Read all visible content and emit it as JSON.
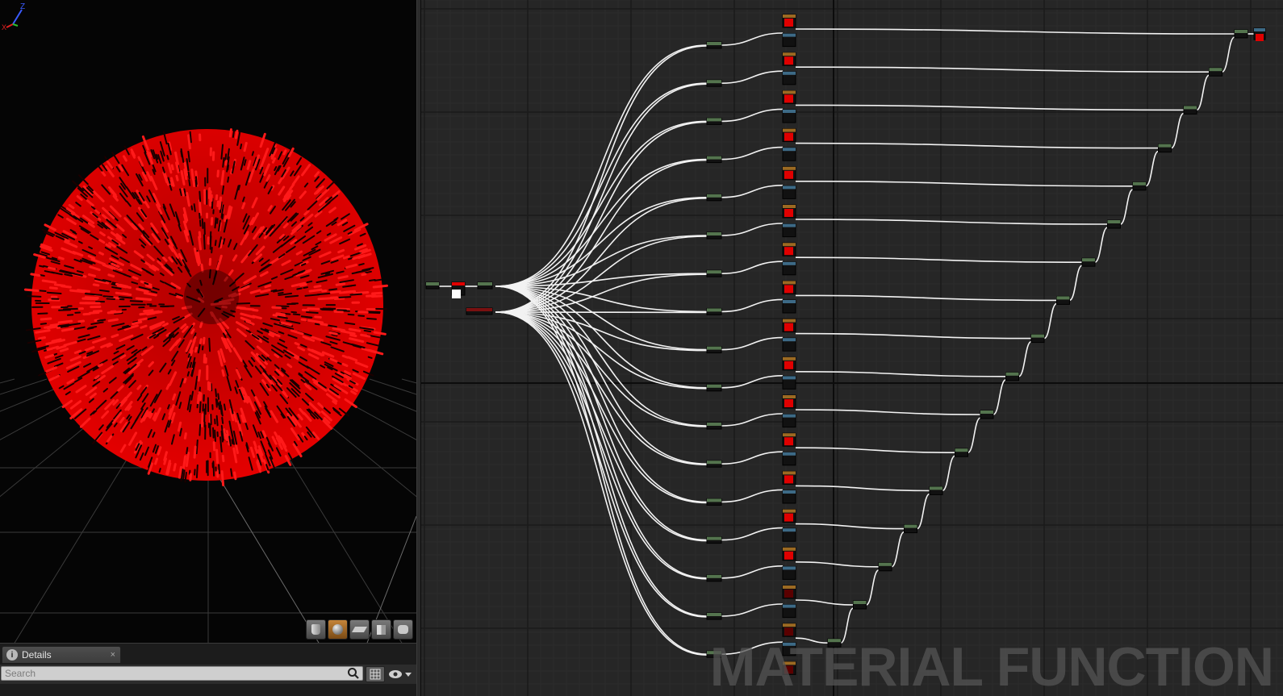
{
  "preview": {
    "sphere_color": "#e10000",
    "toolbar": [
      {
        "name": "preview-cylinder-button",
        "icon": "cylinder-icon",
        "active": false
      },
      {
        "name": "preview-sphere-button",
        "icon": "sphere-icon",
        "active": true
      },
      {
        "name": "preview-plane-button",
        "icon": "plane-icon",
        "active": false
      },
      {
        "name": "preview-cube-button",
        "icon": "cube-icon",
        "active": false
      },
      {
        "name": "preview-mesh-button",
        "icon": "mesh-icon",
        "active": false
      }
    ],
    "axis_labels": {
      "z": "Z",
      "x": "X"
    }
  },
  "details": {
    "tab_label": "Details",
    "tab_close": "×",
    "search_placeholder": "Search"
  },
  "graph": {
    "watermark": "MATERIAL FUNCTION",
    "colors": {
      "background": "#262626",
      "wire": "#f2f2f2",
      "node_green": "#54744e",
      "node_blue": "#3d6a86",
      "node_orange": "#9c6a22",
      "swatch_red": "#e00000"
    }
  }
}
